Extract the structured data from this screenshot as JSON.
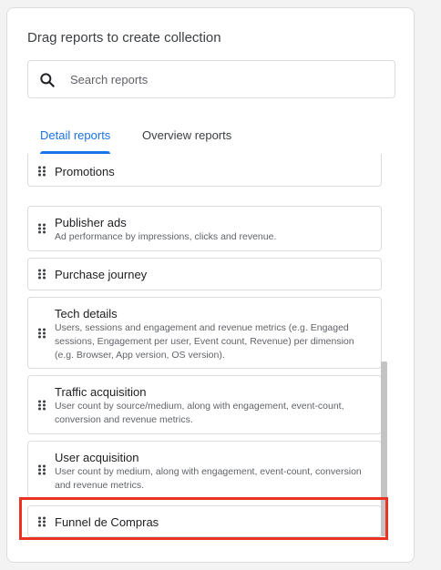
{
  "panel": {
    "heading": "Drag reports to create collection"
  },
  "search": {
    "icon": "search-icon",
    "placeholder": "Search reports"
  },
  "tabs": [
    {
      "label": "Detail reports",
      "active": true
    },
    {
      "label": "Overview reports",
      "active": false
    }
  ],
  "reports": [
    {
      "title": "Promotions",
      "description": ""
    },
    {
      "title": "Publisher ads",
      "description": "Ad performance by impressions, clicks and revenue."
    },
    {
      "title": "Purchase journey",
      "description": ""
    },
    {
      "title": "Tech details",
      "description": "Users, sessions and engagement and revenue metrics (e.g. Engaged sessions, Engagement per user, Event count, Revenue) per dimension (e.g. Browser, App version, OS version)."
    },
    {
      "title": "Traffic acquisition",
      "description": "User count by source/medium, along with engagement, event-count, conversion and revenue metrics."
    },
    {
      "title": "User acquisition",
      "description": "User count by medium, along with engagement, event-count, conversion and revenue metrics."
    },
    {
      "title": "Funnel de Compras",
      "description": ""
    }
  ],
  "colors": {
    "accent": "#1a73e8",
    "highlight": "#ea3323"
  }
}
